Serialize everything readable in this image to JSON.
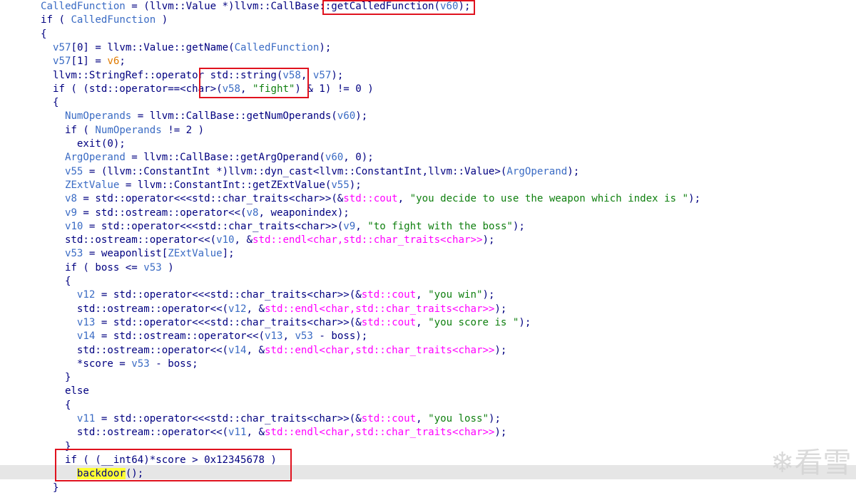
{
  "code_view": {
    "lines": [
      [
        [
          "t-var",
          "CalledFunction"
        ],
        [
          "t-plain",
          " = (llvm::Value *)llvm::CallBase::getCalledFunction("
        ],
        [
          "t-var",
          "v60"
        ],
        [
          "t-plain",
          ");"
        ]
      ],
      [
        [
          "t-plain",
          "if ( "
        ],
        [
          "t-var",
          "CalledFunction"
        ],
        [
          "t-plain",
          " )"
        ]
      ],
      [
        [
          "t-plain",
          "{"
        ]
      ],
      [
        [
          "t-plain",
          "  "
        ],
        [
          "t-var",
          "v57"
        ],
        [
          "t-plain",
          "[0] = llvm::Value::getName("
        ],
        [
          "t-var",
          "CalledFunction"
        ],
        [
          "t-plain",
          ");"
        ]
      ],
      [
        [
          "t-plain",
          "  "
        ],
        [
          "t-var",
          "v57"
        ],
        [
          "t-plain",
          "[1] = "
        ],
        [
          "t-warn",
          "v6"
        ],
        [
          "t-plain",
          ";"
        ]
      ],
      [
        [
          "t-plain",
          "  llvm::StringRef::operator std::string("
        ],
        [
          "t-var",
          "v58"
        ],
        [
          "t-plain",
          ", "
        ],
        [
          "t-var",
          "v57"
        ],
        [
          "t-plain",
          ");"
        ]
      ],
      [
        [
          "t-plain",
          "  if ( (std::operator==<char>("
        ],
        [
          "t-var",
          "v58"
        ],
        [
          "t-plain",
          ", "
        ],
        [
          "t-str",
          "\"fight\""
        ],
        [
          "t-plain",
          ") & 1) != 0 )"
        ]
      ],
      [
        [
          "t-plain",
          "  {"
        ]
      ],
      [
        [
          "t-plain",
          "    "
        ],
        [
          "t-var",
          "NumOperands"
        ],
        [
          "t-plain",
          " = llvm::CallBase::getNumOperands("
        ],
        [
          "t-var",
          "v60"
        ],
        [
          "t-plain",
          ");"
        ]
      ],
      [
        [
          "t-plain",
          "    if ( "
        ],
        [
          "t-var",
          "NumOperands"
        ],
        [
          "t-plain",
          " != 2 )"
        ]
      ],
      [
        [
          "t-plain",
          "      exit(0);"
        ]
      ],
      [
        [
          "t-plain",
          "    "
        ],
        [
          "t-var",
          "ArgOperand"
        ],
        [
          "t-plain",
          " = llvm::CallBase::getArgOperand("
        ],
        [
          "t-var",
          "v60"
        ],
        [
          "t-plain",
          ", 0);"
        ]
      ],
      [
        [
          "t-plain",
          "    "
        ],
        [
          "t-var",
          "v55"
        ],
        [
          "t-plain",
          " = (llvm::ConstantInt *)llvm::dyn_cast<llvm::ConstantInt,llvm::Value>("
        ],
        [
          "t-var",
          "ArgOperand"
        ],
        [
          "t-plain",
          ");"
        ]
      ],
      [
        [
          "t-plain",
          "    "
        ],
        [
          "t-var",
          "ZExtValue"
        ],
        [
          "t-plain",
          " = llvm::ConstantInt::getZExtValue("
        ],
        [
          "t-var",
          "v55"
        ],
        [
          "t-plain",
          ");"
        ]
      ],
      [
        [
          "t-plain",
          "    "
        ],
        [
          "t-var",
          "v8"
        ],
        [
          "t-plain",
          " = std::operator<<<std::char_traits<char>>(&"
        ],
        [
          "t-lib",
          "std::cout"
        ],
        [
          "t-plain",
          ", "
        ],
        [
          "t-str",
          "\"you decide to use the weapon which index is \""
        ],
        [
          "t-plain",
          ");"
        ]
      ],
      [
        [
          "t-plain",
          "    "
        ],
        [
          "t-var",
          "v9"
        ],
        [
          "t-plain",
          " = std::ostream::operator<<("
        ],
        [
          "t-var",
          "v8"
        ],
        [
          "t-plain",
          ", weaponindex);"
        ]
      ],
      [
        [
          "t-plain",
          "    "
        ],
        [
          "t-var",
          "v10"
        ],
        [
          "t-plain",
          " = std::operator<<<std::char_traits<char>>("
        ],
        [
          "t-var",
          "v9"
        ],
        [
          "t-plain",
          ", "
        ],
        [
          "t-str",
          "\"to fight with the boss\""
        ],
        [
          "t-plain",
          ");"
        ]
      ],
      [
        [
          "t-plain",
          "    std::ostream::operator<<("
        ],
        [
          "t-var",
          "v10"
        ],
        [
          "t-plain",
          ", &"
        ],
        [
          "t-lib",
          "std::endl<char,std::char_traits<char>>"
        ],
        [
          "t-plain",
          ");"
        ]
      ],
      [
        [
          "t-plain",
          "    "
        ],
        [
          "t-var",
          "v53"
        ],
        [
          "t-plain",
          " = weaponlist["
        ],
        [
          "t-var",
          "ZExtValue"
        ],
        [
          "t-plain",
          "];"
        ]
      ],
      [
        [
          "t-plain",
          "    if ( boss <= "
        ],
        [
          "t-var",
          "v53"
        ],
        [
          "t-plain",
          " )"
        ]
      ],
      [
        [
          "t-plain",
          "    {"
        ]
      ],
      [
        [
          "t-plain",
          "      "
        ],
        [
          "t-var",
          "v12"
        ],
        [
          "t-plain",
          " = std::operator<<<std::char_traits<char>>(&"
        ],
        [
          "t-lib",
          "std::cout"
        ],
        [
          "t-plain",
          ", "
        ],
        [
          "t-str",
          "\"you win\""
        ],
        [
          "t-plain",
          ");"
        ]
      ],
      [
        [
          "t-plain",
          "      std::ostream::operator<<("
        ],
        [
          "t-var",
          "v12"
        ],
        [
          "t-plain",
          ", &"
        ],
        [
          "t-lib",
          "std::endl<char,std::char_traits<char>>"
        ],
        [
          "t-plain",
          ");"
        ]
      ],
      [
        [
          "t-plain",
          "      "
        ],
        [
          "t-var",
          "v13"
        ],
        [
          "t-plain",
          " = std::operator<<<std::char_traits<char>>(&"
        ],
        [
          "t-lib",
          "std::cout"
        ],
        [
          "t-plain",
          ", "
        ],
        [
          "t-str",
          "\"you score is \""
        ],
        [
          "t-plain",
          ");"
        ]
      ],
      [
        [
          "t-plain",
          "      "
        ],
        [
          "t-var",
          "v14"
        ],
        [
          "t-plain",
          " = std::ostream::operator<<("
        ],
        [
          "t-var",
          "v13"
        ],
        [
          "t-plain",
          ", "
        ],
        [
          "t-var",
          "v53"
        ],
        [
          "t-plain",
          " - boss);"
        ]
      ],
      [
        [
          "t-plain",
          "      std::ostream::operator<<("
        ],
        [
          "t-var",
          "v14"
        ],
        [
          "t-plain",
          ", &"
        ],
        [
          "t-lib",
          "std::endl<char,std::char_traits<char>>"
        ],
        [
          "t-plain",
          ");"
        ]
      ],
      [
        [
          "t-plain",
          "      *score = "
        ],
        [
          "t-var",
          "v53"
        ],
        [
          "t-plain",
          " - boss;"
        ]
      ],
      [
        [
          "t-plain",
          "    }"
        ]
      ],
      [
        [
          "t-plain",
          "    else"
        ]
      ],
      [
        [
          "t-plain",
          "    {"
        ]
      ],
      [
        [
          "t-plain",
          "      "
        ],
        [
          "t-var",
          "v11"
        ],
        [
          "t-plain",
          " = std::operator<<<std::char_traits<char>>(&"
        ],
        [
          "t-lib",
          "std::cout"
        ],
        [
          "t-plain",
          ", "
        ],
        [
          "t-str",
          "\"you loss\""
        ],
        [
          "t-plain",
          ");"
        ]
      ],
      [
        [
          "t-plain",
          "      std::ostream::operator<<("
        ],
        [
          "t-var",
          "v11"
        ],
        [
          "t-plain",
          ", &"
        ],
        [
          "t-lib",
          "std::endl<char,std::char_traits<char>>"
        ],
        [
          "t-plain",
          ");"
        ]
      ],
      [
        [
          "t-plain",
          "    }"
        ]
      ],
      [
        [
          "t-plain",
          "    if ( (__int64)*score > 0x12345678 )"
        ]
      ],
      [
        [
          "t-plain",
          "      "
        ],
        [
          "t-hl",
          "backdoor"
        ],
        [
          "t-plain",
          "();"
        ]
      ],
      [
        [
          "t-plain",
          "  }"
        ]
      ]
    ]
  },
  "watermark": {
    "text": "看雪"
  },
  "colors": {
    "code_text": "#000080",
    "variable": "#3a6bc4",
    "string": "#108010",
    "library": "#ff00ff",
    "warning_var": "#e07a00",
    "highlight": "#ffff33",
    "annotation_box": "#e0121e",
    "current_line": "#e6e6e6"
  }
}
